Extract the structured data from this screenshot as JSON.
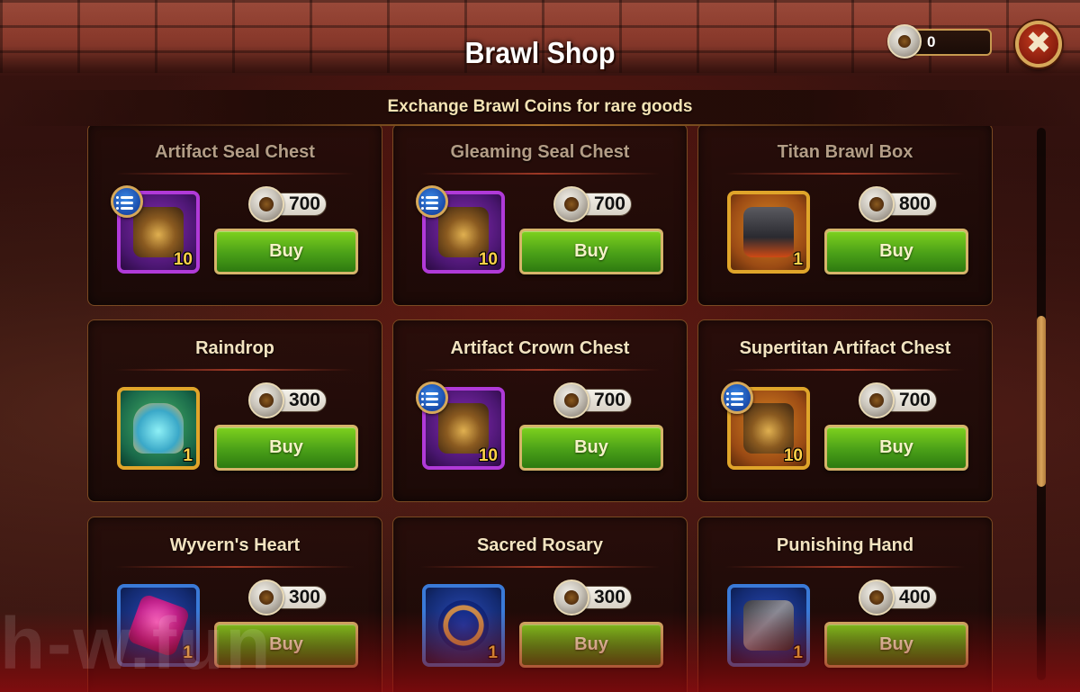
{
  "header": {
    "title": "Brawl Shop",
    "currency_amount": "0",
    "close_label": "✖"
  },
  "subtitle": "Exchange Brawl Coins for rare goods",
  "buy_label": "Buy",
  "items": [
    {
      "name": "Artifact Seal Chest",
      "price": "700",
      "qty": "10",
      "tile": "purple",
      "art": "chest-icon",
      "info": true
    },
    {
      "name": "Gleaming Seal Chest",
      "price": "700",
      "qty": "10",
      "tile": "purple",
      "art": "chest-icon",
      "info": true
    },
    {
      "name": "Titan Brawl Box",
      "price": "800",
      "qty": "1",
      "tile": "gold",
      "art": "box-icon",
      "info": false
    },
    {
      "name": "Raindrop",
      "price": "300",
      "qty": "1",
      "tile": "gold-green",
      "art": "jar-icon",
      "info": false
    },
    {
      "name": "Artifact Crown Chest",
      "price": "700",
      "qty": "10",
      "tile": "purple",
      "art": "chest-icon",
      "info": true
    },
    {
      "name": "Supertitan Artifact Chest",
      "price": "700",
      "qty": "10",
      "tile": "gold",
      "art": "chest-icon",
      "info": true
    },
    {
      "name": "Wyvern's Heart",
      "price": "300",
      "qty": "1",
      "tile": "blue",
      "art": "gem-icon",
      "info": false
    },
    {
      "name": "Sacred Rosary",
      "price": "300",
      "qty": "1",
      "tile": "blue",
      "art": "rosary-icon",
      "info": false
    },
    {
      "name": "Punishing Hand",
      "price": "400",
      "qty": "1",
      "tile": "blue",
      "art": "gauntlet-icon",
      "info": false
    }
  ],
  "watermark": "h-w.fun"
}
